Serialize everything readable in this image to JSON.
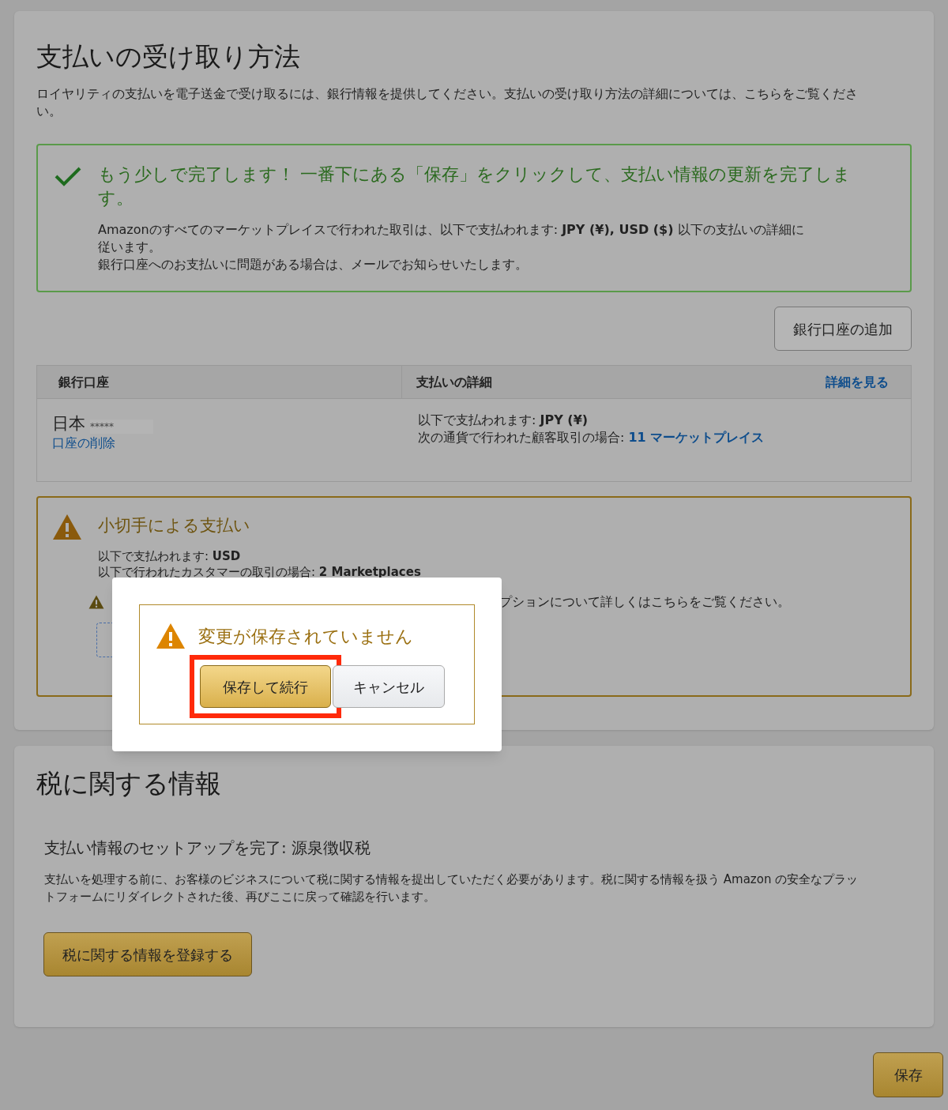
{
  "payment_section": {
    "title": "支払いの受け取り方法",
    "intro": "ロイヤリティの支払いを電子送金で受け取るには、銀行情報を提供してください。支払いの受け取り方法の詳細については、こちらをご覧ください。",
    "success_alert": {
      "heading": "もう少しで完了します！ 一番下にある「保存」をクリックして、支払い情報の更新を完了します。",
      "lines": [
        "Amazonのすべてのマーケットプレイスで行われた取引は、以下で支払われます: **JPY (¥), USD ($)** 以下の支払いの詳細に従います。",
        "銀行口座へのお支払いに問題がある場合は、メールでお知らせいたします。"
      ]
    },
    "add_bank_button": "銀行口座の追加",
    "table": {
      "columns": [
        "銀行口座",
        "支払いの詳細"
      ],
      "details_link": "詳細を見る",
      "rows": [
        {
          "country": "日本",
          "masked_number": "*****",
          "delete_link": "口座の削除",
          "paid_in": "以下で支払われます: **JPY (¥)**",
          "marketplaces_label": "次の通貨で行われた顧客取引の場合:",
          "marketplaces_link": "11 マーケットプレイス"
        }
      ]
    },
    "check_alert": {
      "heading": "小切手による支払い",
      "lines": [
        "以下で支払われます: **USD**",
        "以下で行われたカスタマーの取引の場合: **2 Marketplaces**"
      ],
      "note": "プションについて詳しくはこちらをご覧ください。"
    }
  },
  "tax_section": {
    "title": "税に関する情報",
    "subtitle": "支払い情報のセットアップを完了: 源泉徴収税",
    "body": "支払いを処理する前に、お客様のビジネスについて税に関する情報を提出していただく必要があります。税に関する情報を扱う Amazon の安全なプラットフォームにリダイレクトされた後、再びここに戻って確認を行います。",
    "button": "税に関する情報を登録する"
  },
  "save_button": "保存",
  "dialog": {
    "message": "変更が保存されていません",
    "buttons": [
      {
        "label": "保存して続行",
        "kind": "primary",
        "highlighted": true
      },
      {
        "label": "キャンセル",
        "kind": "secondary",
        "highlighted": false
      }
    ]
  }
}
